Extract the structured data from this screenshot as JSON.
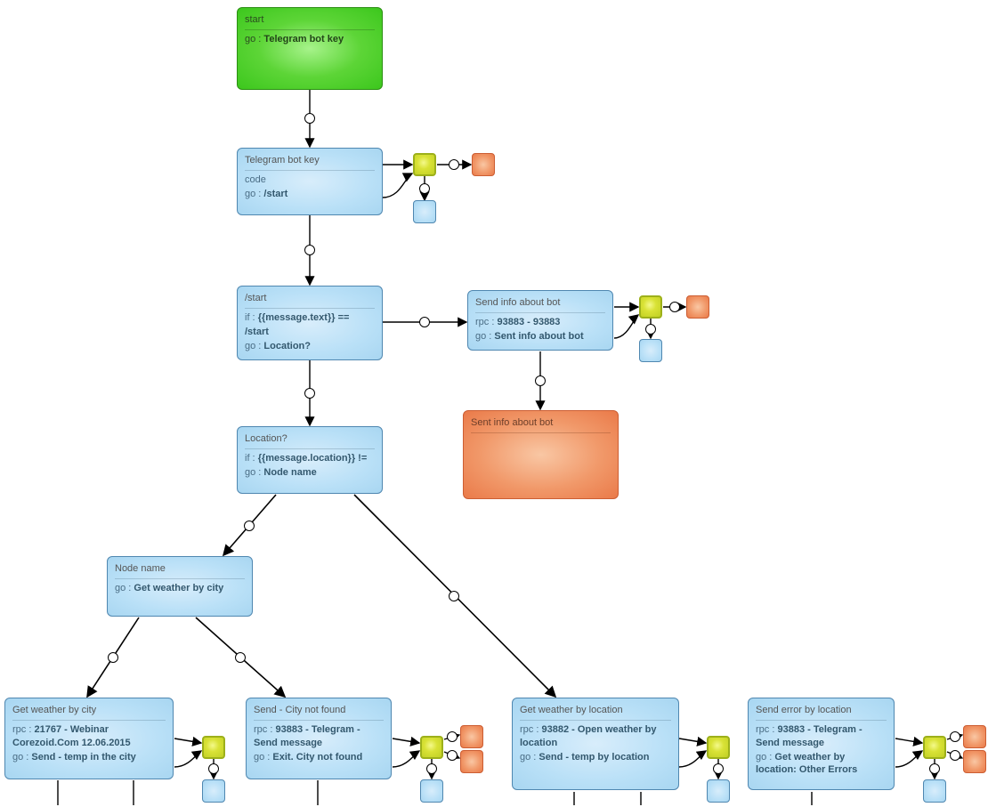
{
  "nodes": {
    "start": {
      "title": "start",
      "lines": [
        {
          "k": "go :",
          "v": "Telegram bot key"
        }
      ]
    },
    "botkey": {
      "title": "Telegram bot key",
      "lines": [
        {
          "k": "code",
          "v": ""
        },
        {
          "k": "go :",
          "v": "/start"
        }
      ]
    },
    "startcmd": {
      "title": "/start",
      "lines": [
        {
          "k": "if :",
          "v": "{{message.text}} =="
        },
        {
          "k": "/start",
          "v": ""
        },
        {
          "k": "go :",
          "v": "Location?"
        }
      ]
    },
    "sendinfo": {
      "title": "Send info about bot",
      "lines": [
        {
          "k": "rpc :",
          "v": "93883 - 93883"
        },
        {
          "k": "go :",
          "v": "Sent info about bot"
        }
      ]
    },
    "sentinfo": {
      "title": "Sent info about bot",
      "lines": []
    },
    "location": {
      "title": "Location?",
      "lines": [
        {
          "k": "if :",
          "v": "{{message.location}} !="
        },
        {
          "k": "go :",
          "v": "Node name"
        }
      ]
    },
    "nodename": {
      "title": "Node name",
      "lines": [
        {
          "k": "go :",
          "v": "Get weather by city"
        }
      ]
    },
    "getcity": {
      "title": "Get weather by city",
      "lines": [
        {
          "k": "rpc :",
          "v": "21767 - Webinar Corezoid.Com 12.06.2015"
        },
        {
          "k": "go :",
          "v": "Send - temp in the city"
        }
      ]
    },
    "citynot": {
      "title": "Send - City not found",
      "lines": [
        {
          "k": "rpc :",
          "v": "93883 - Telegram - Send message"
        },
        {
          "k": "go :",
          "v": "Exit. City not found"
        }
      ]
    },
    "getloc": {
      "title": "Get weather by location",
      "lines": [
        {
          "k": "rpc :",
          "v": "93882 - Open weather by location"
        },
        {
          "k": "go :",
          "v": "Send - temp by location"
        }
      ]
    },
    "errloc": {
      "title": "Send error by location",
      "lines": [
        {
          "k": "rpc :",
          "v": "93883 - Telegram - Send message"
        },
        {
          "k": "go :",
          "v": "Get weather by location: Other Errors"
        }
      ]
    }
  }
}
